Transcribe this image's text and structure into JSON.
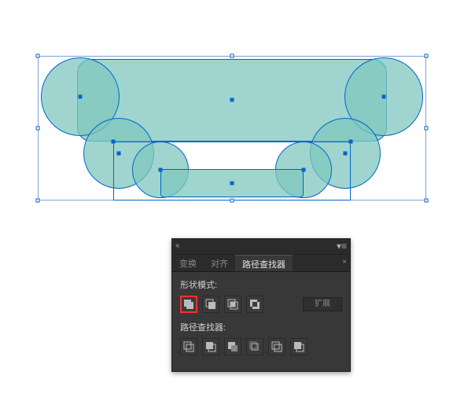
{
  "panel": {
    "tabs": {
      "transform": "变换",
      "align": "对齐",
      "pathfinder": "路径查找器"
    },
    "shape_modes_label": "形状模式:",
    "expand_label": "扩展",
    "pathfinder_label": "路径查找器:"
  },
  "colors": {
    "shape_fill": "#7fc7bd",
    "selection": "#0066cc",
    "highlight": "#ff3030"
  }
}
